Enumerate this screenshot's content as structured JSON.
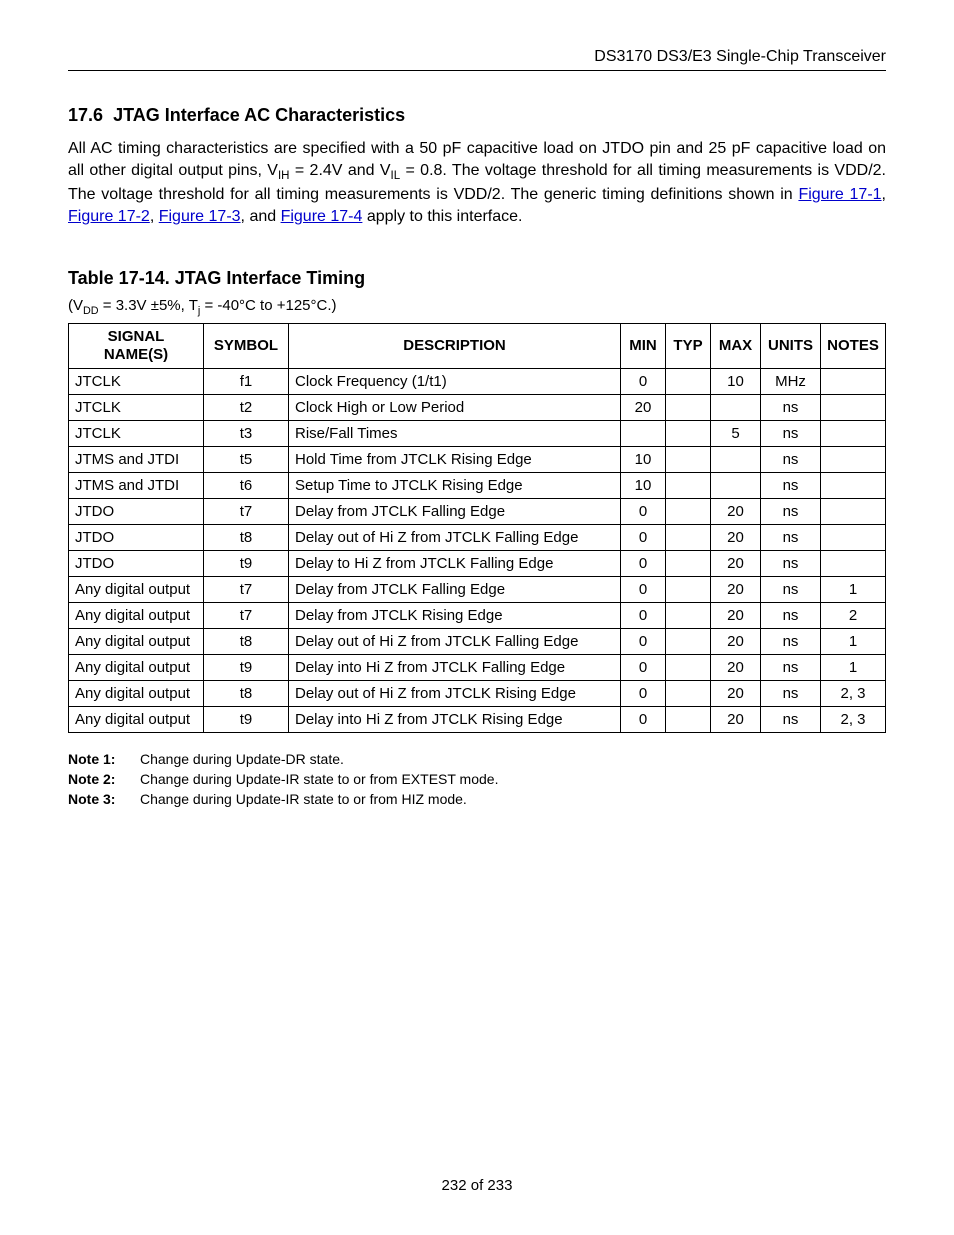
{
  "header": {
    "doc_title": "DS3170 DS3/E3 Single-Chip Transceiver"
  },
  "section": {
    "number": "17.6",
    "title": "JTAG Interface AC Characteristics",
    "para_pre": "All AC timing characteristics are specified with a 50 pF capacitive load on JTDO pin and 25 pF capacitive load on all other digital output pins, V",
    "para_ih_sub": "IH",
    "para_mid1": " = 2.4V and V",
    "para_il_sub": "IL",
    "para_mid2": " = 0.8. The voltage threshold for all timing measurements is VDD/2. The voltage threshold for all timing measurements is VDD/2. The generic timing definitions shown in ",
    "link1": "Figure 17-1",
    "sep1": ", ",
    "link2": "Figure 17-2",
    "sep2": ", ",
    "link3": "Figure 17-3",
    "sep3": ", and ",
    "link4": "Figure 17-4",
    "para_end": " apply to this interface."
  },
  "table": {
    "title": "Table 17-14. JTAG Interface Timing",
    "cond_pre": "(V",
    "cond_dd": "DD",
    "cond_mid": " = 3.3V ±5%, T",
    "cond_j": "j",
    "cond_end": " = -40°C to +125°C.)",
    "headers": {
      "signal": "SIGNAL NAME(S)",
      "symbol": "SYMBOL",
      "desc": "DESCRIPTION",
      "min": "MIN",
      "typ": "TYP",
      "max": "MAX",
      "units": "UNITS",
      "notes": "NOTES"
    },
    "rows": [
      {
        "signal": "JTCLK",
        "symbol": "f1",
        "desc": "Clock Frequency (1/t1)",
        "min": "0",
        "typ": "",
        "max": "10",
        "units": "MHz",
        "notes": ""
      },
      {
        "signal": "JTCLK",
        "symbol": "t2",
        "desc": "Clock High or Low Period",
        "min": "20",
        "typ": "",
        "max": "",
        "units": "ns",
        "notes": ""
      },
      {
        "signal": "JTCLK",
        "symbol": "t3",
        "desc": "Rise/Fall Times",
        "min": "",
        "typ": "",
        "max": "5",
        "units": "ns",
        "notes": ""
      },
      {
        "signal": "JTMS and JTDI",
        "symbol": "t5",
        "desc": "Hold Time from JTCLK Rising Edge",
        "min": "10",
        "typ": "",
        "max": "",
        "units": "ns",
        "notes": ""
      },
      {
        "signal": "JTMS and JTDI",
        "symbol": "t6",
        "desc": "Setup Time to JTCLK Rising Edge",
        "min": "10",
        "typ": "",
        "max": "",
        "units": "ns",
        "notes": ""
      },
      {
        "signal": "JTDO",
        "symbol": "t7",
        "desc": "Delay from JTCLK Falling Edge",
        "min": "0",
        "typ": "",
        "max": "20",
        "units": "ns",
        "notes": ""
      },
      {
        "signal": "JTDO",
        "symbol": "t8",
        "desc": "Delay out of Hi Z from JTCLK Falling Edge",
        "min": "0",
        "typ": "",
        "max": "20",
        "units": "ns",
        "notes": ""
      },
      {
        "signal": "JTDO",
        "symbol": "t9",
        "desc": "Delay to Hi Z from JTCLK Falling Edge",
        "min": "0",
        "typ": "",
        "max": "20",
        "units": "ns",
        "notes": ""
      },
      {
        "signal": "Any digital output",
        "symbol": "t7",
        "desc": "Delay from JTCLK Falling Edge",
        "min": "0",
        "typ": "",
        "max": "20",
        "units": "ns",
        "notes": "1"
      },
      {
        "signal": "Any digital output",
        "symbol": "t7",
        "desc": "Delay from JTCLK Rising Edge",
        "min": "0",
        "typ": "",
        "max": "20",
        "units": "ns",
        "notes": "2"
      },
      {
        "signal": "Any digital output",
        "symbol": "t8",
        "desc": "Delay out of Hi Z from JTCLK Falling Edge",
        "min": "0",
        "typ": "",
        "max": "20",
        "units": "ns",
        "notes": "1"
      },
      {
        "signal": "Any digital output",
        "symbol": "t9",
        "desc": "Delay into Hi Z from JTCLK Falling Edge",
        "min": "0",
        "typ": "",
        "max": "20",
        "units": "ns",
        "notes": "1"
      },
      {
        "signal": "Any digital output",
        "symbol": "t8",
        "desc": "Delay out of Hi Z from JTCLK Rising Edge",
        "min": "0",
        "typ": "",
        "max": "20",
        "units": "ns",
        "notes": "2, 3"
      },
      {
        "signal": "Any digital output",
        "symbol": "t9",
        "desc": "Delay into Hi Z from JTCLK Rising Edge",
        "min": "0",
        "typ": "",
        "max": "20",
        "units": "ns",
        "notes": "2, 3"
      }
    ]
  },
  "notes": [
    {
      "label": "Note 1:",
      "text": "Change during Update-DR state."
    },
    {
      "label": "Note 2:",
      "text": "Change during Update-IR state to or from EXTEST mode."
    },
    {
      "label": "Note 3:",
      "text": "Change during Update-IR state to or from HIZ mode."
    }
  ],
  "footer": {
    "page": "232 of 233"
  }
}
